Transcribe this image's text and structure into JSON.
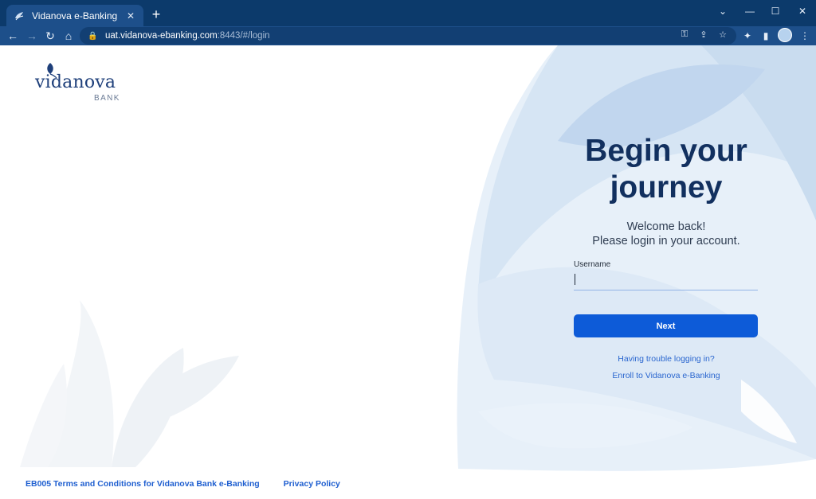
{
  "browser": {
    "tab_title": "Vidanova e-Banking",
    "tab_close": "✕",
    "new_tab": "+",
    "url_host": "uat.vidanova-ebanking.com",
    "url_rest": ":8443/#/login",
    "window_controls": {
      "minimize": "⌄",
      "restore": "—",
      "maximize": "☐",
      "close": "✕"
    }
  },
  "logo": {
    "name": "vidanova",
    "sub": "BANK"
  },
  "login": {
    "heading_line1": "Begin your",
    "heading_line2": "journey",
    "welcome_line1": "Welcome back!",
    "welcome_line2": "Please login in your account.",
    "username_label": "Username",
    "username_value": "",
    "next_button": "Next",
    "trouble_link": "Having trouble logging in?",
    "enroll_link": "Enroll to Vidanova e-Banking"
  },
  "footer": {
    "terms": "EB005 Terms and Conditions for Vidanova Bank e-Banking",
    "privacy": "Privacy Policy"
  },
  "colors": {
    "primary": "#0d5bd8",
    "heading": "#12305f",
    "chrome": "#0c3a6b",
    "link": "#2a66cf"
  }
}
